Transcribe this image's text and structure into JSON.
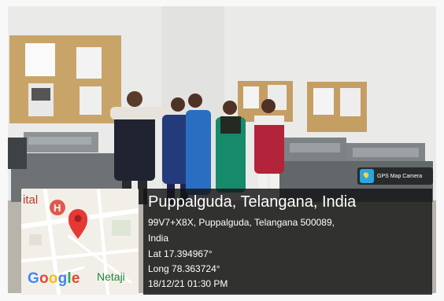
{
  "badge": {
    "label": "GPS Map Camera",
    "icon": "gps-map-camera-icon"
  },
  "map": {
    "label_partial": "ital",
    "label_area": "Netaji",
    "logo": "Google",
    "pin_icon": "map-pin-icon",
    "marker_letter": "H"
  },
  "location": {
    "place": "Puppalguda, Telangana, India",
    "address_line1": "99V7+X8X, Puppalguda, Telangana 500089,",
    "address_line2": "India",
    "latitude": "Lat 17.394967°",
    "longitude": "Long 78.363724°",
    "datetime": "18/12/21 01:30 PM"
  },
  "colors": {
    "pin_red": "#e53935",
    "hospital_marker": "#e05a4b",
    "overlay_dark": "#141414",
    "google_blue": "#4285F4",
    "google_red": "#EA4335",
    "google_yellow": "#FBBC05",
    "google_green": "#34A853"
  }
}
